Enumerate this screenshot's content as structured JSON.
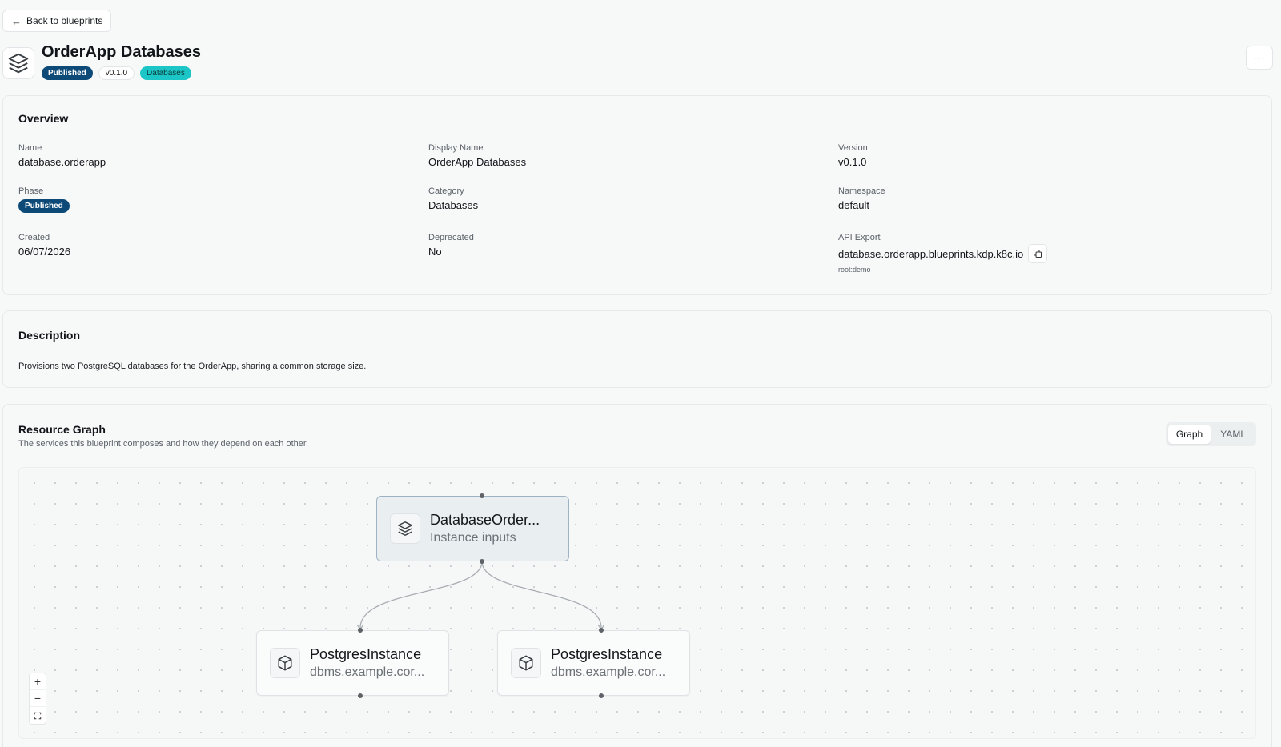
{
  "nav": {
    "back_label": "Back to blueprints"
  },
  "header": {
    "title": "OrderApp Databases",
    "badges": {
      "phase": "Published",
      "version": "v0.1.0",
      "category": "Databases"
    },
    "more_label": "···"
  },
  "overview": {
    "title": "Overview",
    "name": {
      "label": "Name",
      "value": "database.orderapp"
    },
    "display_name": {
      "label": "Display Name",
      "value": "OrderApp Databases"
    },
    "version": {
      "label": "Version",
      "value": "v0.1.0"
    },
    "phase": {
      "label": "Phase",
      "value": "Published"
    },
    "category": {
      "label": "Category",
      "value": "Databases"
    },
    "namespace": {
      "label": "Namespace",
      "value": "default"
    },
    "created": {
      "label": "Created",
      "value": "06/07/2026"
    },
    "deprecated": {
      "label": "Deprecated",
      "value": "No"
    },
    "api_export": {
      "label": "API Export",
      "value": "database.orderapp.blueprints.kdp.k8c.io",
      "note": "root:demo"
    }
  },
  "description": {
    "title": "Description",
    "text": "Provisions two PostgreSQL databases for the OrderApp, sharing a common storage size."
  },
  "resource_graph": {
    "title": "Resource Graph",
    "subtitle": "The services this blueprint composes and how they depend on each other.",
    "view_options": [
      "Graph",
      "YAML"
    ],
    "active_view": "Graph",
    "nodes": [
      {
        "title": "DatabaseOrder...",
        "subtitle": "Instance inputs",
        "icon": "layers-icon"
      },
      {
        "title": "PostgresInstance",
        "subtitle": "dbms.example.cor...",
        "icon": "cube-icon"
      },
      {
        "title": "PostgresInstance",
        "subtitle": "dbms.example.cor...",
        "icon": "cube-icon"
      }
    ],
    "zoom_controls": {
      "zoom_in": "+",
      "zoom_out": "−"
    }
  },
  "colors": {
    "published_badge": "#0d4a78",
    "category_badge": "#1cc6c6",
    "root_node_border": "#9fb2c3",
    "background": "#f7f9f9"
  }
}
